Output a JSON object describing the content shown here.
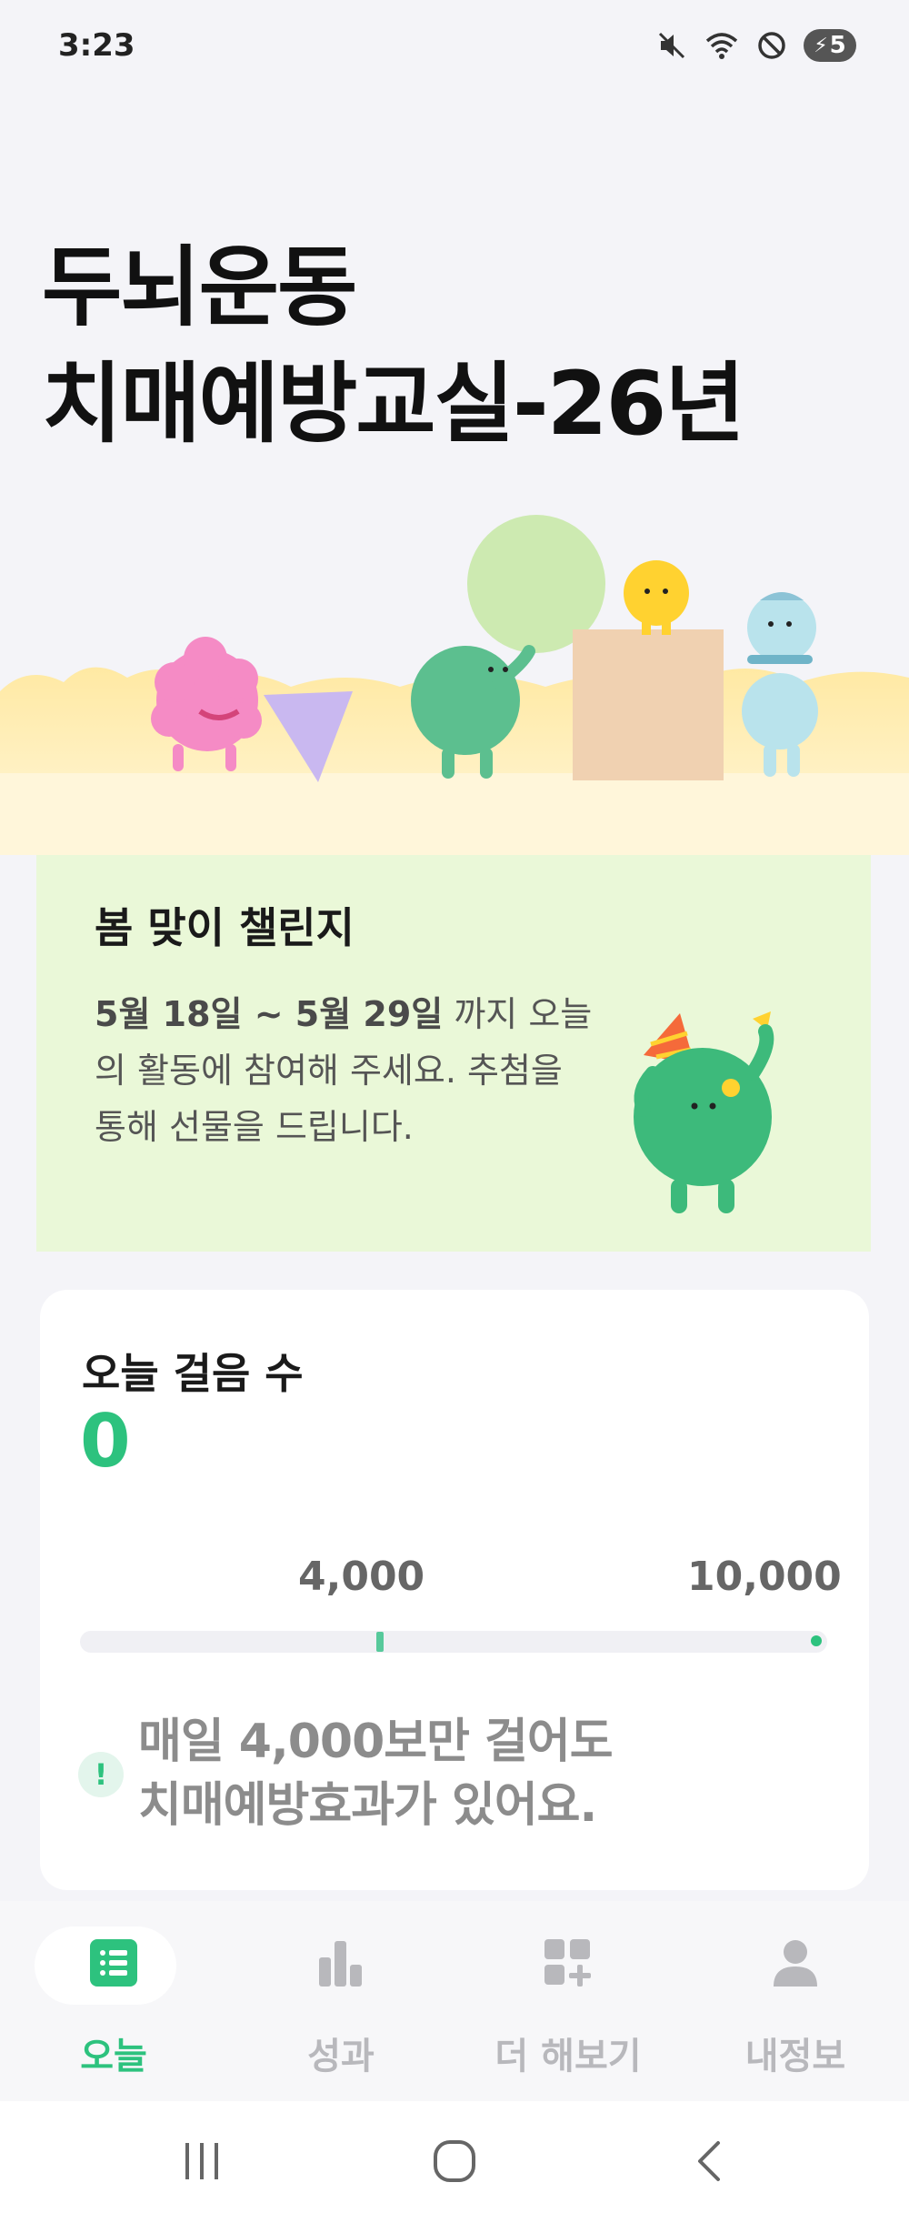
{
  "status_bar": {
    "time": "3:23",
    "battery": "5",
    "icons": [
      "mute-icon",
      "wifi-icon",
      "do-not-disturb-icon",
      "battery-charging-icon"
    ]
  },
  "header": {
    "title_line1": "두뇌운동",
    "title_line2": "치매예방교실-26년"
  },
  "challenge": {
    "title": "봄 맞이 챌린지",
    "date_range": "5월 18일 ~ 5월 29일",
    "description_rest": " 까지 오늘의 활동에 참여해 주세요. 추첨을 통해 선물을 드립니다."
  },
  "steps": {
    "label": "오늘 걸음 수",
    "value": "0",
    "milestone_mid": "4,000",
    "milestone_end": "10,000",
    "progress": 0,
    "tip_icon": "!",
    "tip_line1": "매일 4,000보만 걸어도",
    "tip_line2": "치매예방효과가 있어요."
  },
  "bottom_nav": {
    "items": [
      {
        "label": "오늘",
        "icon": "list-icon",
        "active": true
      },
      {
        "label": "성과",
        "icon": "bar-chart-icon",
        "active": false
      },
      {
        "label": "더 해보기",
        "icon": "add-widget-icon",
        "active": false
      },
      {
        "label": "내정보",
        "icon": "person-icon",
        "active": false
      }
    ]
  },
  "colors": {
    "accent": "#2dc27e",
    "challenge_bg": "#eaf8d8",
    "page_bg": "#f4f4f8",
    "inactive_nav": "#b8b8bc"
  }
}
